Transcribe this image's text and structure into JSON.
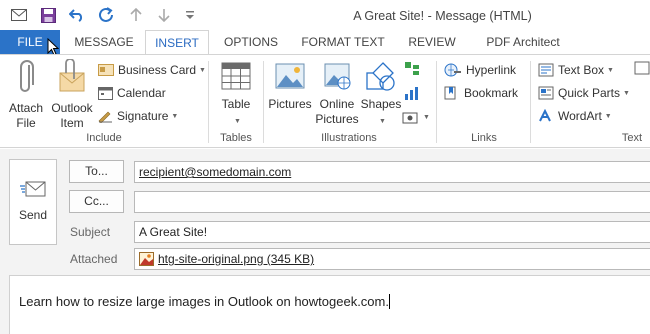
{
  "window": {
    "title": "A Great Site! - Message (HTML)"
  },
  "tabs": [
    {
      "label": "FILE"
    },
    {
      "label": "MESSAGE"
    },
    {
      "label": "INSERT"
    },
    {
      "label": "OPTIONS"
    },
    {
      "label": "FORMAT TEXT"
    },
    {
      "label": "REVIEW"
    },
    {
      "label": "PDF Architect"
    }
  ],
  "ribbon": {
    "include": {
      "label": "Include",
      "attach_file": [
        "Attach",
        "File"
      ],
      "outlook_item": [
        "Outlook",
        "Item"
      ],
      "business_card": "Business Card",
      "calendar": "Calendar",
      "signature": "Signature"
    },
    "tables": {
      "label": "Tables",
      "table": "Table"
    },
    "illustrations": {
      "label": "Illustrations",
      "pictures": "Pictures",
      "online_pictures": [
        "Online",
        "Pictures"
      ],
      "shapes": "Shapes"
    },
    "links": {
      "label": "Links",
      "hyperlink": "Hyperlink",
      "bookmark": "Bookmark"
    },
    "text": {
      "label": "Text",
      "text_box": "Text Box",
      "quick_parts": "Quick Parts",
      "wordart": "WordArt"
    }
  },
  "compose": {
    "send": "Send",
    "to_label": "To...",
    "to_value": "recipient@somedomain.com",
    "cc_label": "Cc...",
    "cc_value": "",
    "subject_label": "Subject",
    "subject_value": "A Great Site!",
    "attached_label": "Attached",
    "attachment": "htg-site-original.png (345 KB)",
    "body": "Learn how to resize large images in Outlook on howtogeek.com."
  },
  "colors": {
    "accent": "#2b73c8",
    "tab_active_text": "#2b6bc2"
  }
}
